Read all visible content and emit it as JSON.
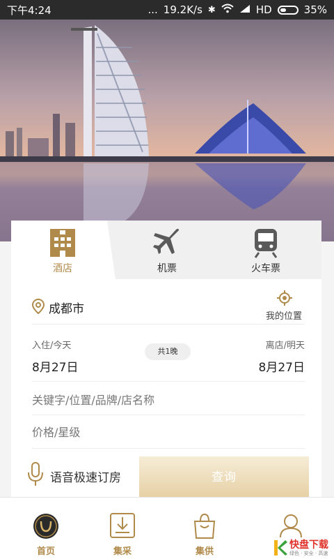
{
  "status_bar": {
    "time": "下午4:24",
    "dots": "...",
    "speed": "19.2K/s",
    "network": "HD",
    "battery": "35%"
  },
  "tabs": [
    {
      "label": "酒店",
      "icon": "hotel-building-icon",
      "active": true
    },
    {
      "label": "机票",
      "icon": "airplane-icon",
      "active": false
    },
    {
      "label": "火车票",
      "icon": "train-icon",
      "active": false
    }
  ],
  "city": {
    "name": "成都市",
    "my_location": "我的位置"
  },
  "dates": {
    "checkin_label": "入住/今天",
    "checkin_date": "8月27日",
    "nights": "共1晚",
    "checkout_label": "离店/明天",
    "checkout_date": "8月27日"
  },
  "search": {
    "keyword_placeholder": "关键字/位置/品牌/店名称",
    "price_placeholder": "价格/星级"
  },
  "voice": {
    "label": "语音极速订房"
  },
  "query_button": "查询",
  "nav": [
    {
      "label": "首页",
      "icon": "home-logo-icon"
    },
    {
      "label": "集采",
      "icon": "download-box-icon"
    },
    {
      "label": "集供",
      "icon": "shopping-bag-icon"
    },
    {
      "label": "",
      "icon": "user-icon"
    }
  ],
  "watermark": {
    "title": "快盘下载",
    "subtitle": "绿色 · 安全 · 高速"
  },
  "colors": {
    "accent": "#b08a4a",
    "status_bar": "#2b2b2b"
  }
}
